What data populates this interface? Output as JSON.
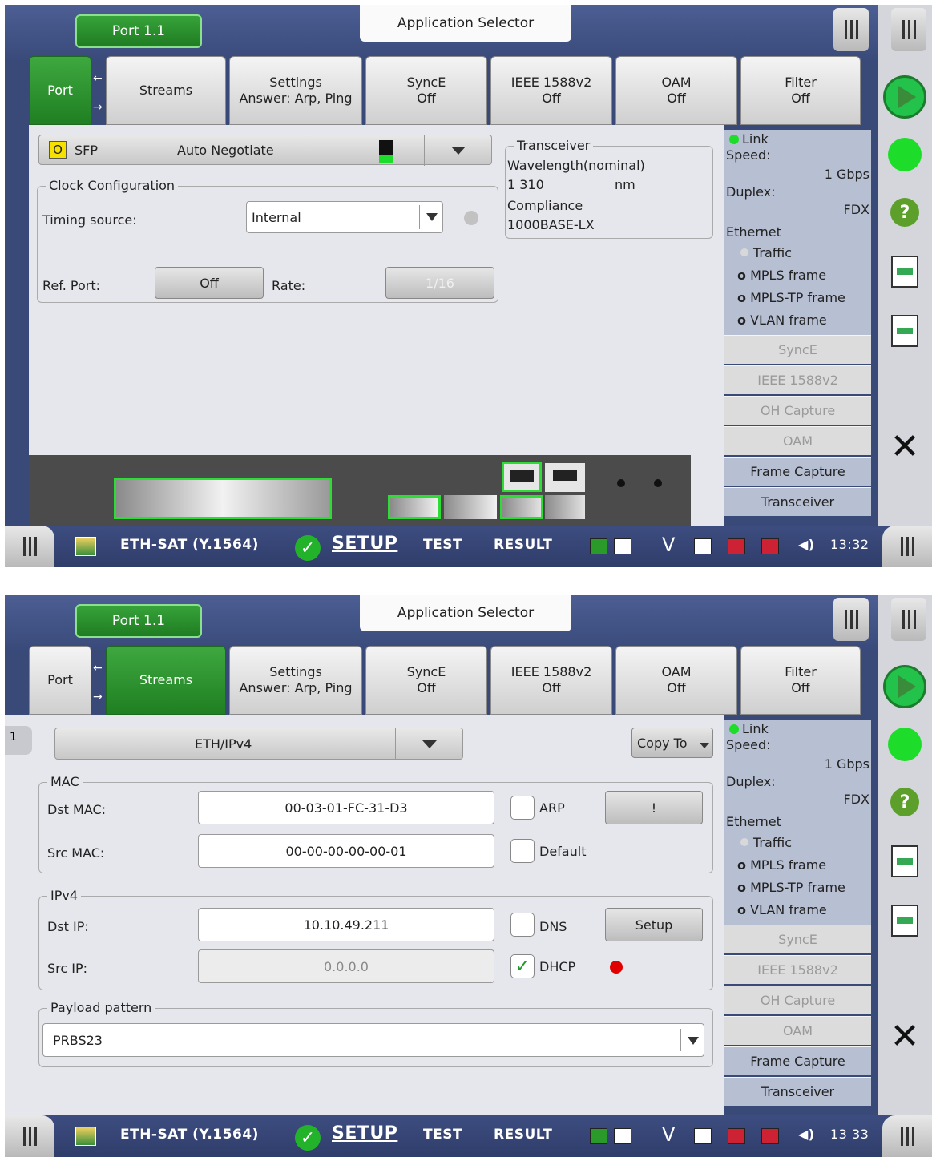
{
  "screens": [
    {
      "port_tab": "Port 1.1",
      "app_selector": "Application Selector",
      "tabs": [
        {
          "line1": "Port",
          "line2": ""
        },
        {
          "line1": "Streams",
          "line2": ""
        },
        {
          "line1": "Settings",
          "line2": "Answer: Arp, Ping"
        },
        {
          "line1": "SyncE",
          "line2": "Off"
        },
        {
          "line1": "IEEE 1588v2",
          "line2": "Off"
        },
        {
          "line1": "OAM",
          "line2": "Off"
        },
        {
          "line1": "Filter",
          "line2": "Off"
        }
      ],
      "active_tab": "Port",
      "port_panel": {
        "sfp_badge": "O",
        "sfp_label": "SFP",
        "negotiation": "Auto Negotiate",
        "clock_title": "Clock Configuration",
        "timing_label": "Timing source:",
        "timing_value": "Internal",
        "ref_port_label": "Ref. Port:",
        "ref_port_value": "Off",
        "rate_label": "Rate:",
        "rate_value": "1/16",
        "transceiver_title": "Transceiver",
        "wavelength_label": "Wavelength(nominal)",
        "wavelength_value": "1 310",
        "wavelength_unit": "nm",
        "compliance_label": "Compliance",
        "compliance_value": "1000BASE-LX"
      },
      "status": {
        "link": "Link",
        "speed_label": "Speed:",
        "speed_value": "1 Gbps",
        "duplex_label": "Duplex:",
        "duplex_value": "FDX",
        "ethernet": "Ethernet",
        "traffic": "Traffic",
        "mpls": "MPLS frame",
        "mpls_tp": "MPLS-TP frame",
        "vlan": "VLAN frame",
        "buttons": [
          "SyncE",
          "IEEE 1588v2",
          "OH Capture",
          "OAM",
          "Frame Capture",
          "Transceiver"
        ]
      },
      "bottom": {
        "app": "ETH-SAT (Y.1564)",
        "setup": "SETUP",
        "test": "TEST",
        "result": "RESULT",
        "v": "V",
        "time": "13:32"
      }
    },
    {
      "port_tab": "Port 1.1",
      "app_selector": "Application Selector",
      "tabs": [
        {
          "line1": "Port",
          "line2": ""
        },
        {
          "line1": "Streams",
          "line2": ""
        },
        {
          "line1": "Settings",
          "line2": "Answer: Arp, Ping"
        },
        {
          "line1": "SyncE",
          "line2": "Off"
        },
        {
          "line1": "IEEE 1588v2",
          "line2": "Off"
        },
        {
          "line1": "OAM",
          "line2": "Off"
        },
        {
          "line1": "Filter",
          "line2": "Off"
        }
      ],
      "active_tab": "Streams",
      "streams_panel": {
        "stream_number": "1",
        "frame_format": "ETH/IPv4",
        "copy_to": "Copy To",
        "mac_title": "MAC",
        "dst_mac_label": "Dst MAC:",
        "dst_mac_value": "00-03-01-FC-31-D3",
        "arp_label": "ARP",
        "arp_btn": "!",
        "src_mac_label": "Src MAC:",
        "src_mac_value": "00-00-00-00-00-01",
        "default_label": "Default",
        "ipv4_title": "IPv4",
        "dst_ip_label": "Dst IP:",
        "dst_ip_value": "10.10.49.211",
        "dns_label": "DNS",
        "setup_btn": "Setup",
        "src_ip_label": "Src IP:",
        "src_ip_value": "0.0.0.0",
        "dhcp_label": "DHCP",
        "dhcp_checked": "✓",
        "payload_title": "Payload pattern",
        "payload_value": "PRBS23"
      },
      "status": {
        "link": "Link",
        "speed_label": "Speed:",
        "speed_value": "1 Gbps",
        "duplex_label": "Duplex:",
        "duplex_value": "FDX",
        "ethernet": "Ethernet",
        "traffic": "Traffic",
        "mpls": "MPLS frame",
        "mpls_tp": "MPLS-TP frame",
        "vlan": "VLAN frame",
        "buttons": [
          "SyncE",
          "IEEE 1588v2",
          "OH Capture",
          "OAM",
          "Frame Capture",
          "Transceiver"
        ]
      },
      "bottom": {
        "app": "ETH-SAT (Y.1564)",
        "setup": "SETUP",
        "test": "TEST",
        "result": "RESULT",
        "v": "V",
        "time": "13 33"
      }
    }
  ],
  "colors": {
    "active_green": "#1f7f22",
    "link_green": "#1edc2a",
    "dhcp_red": "#e00000",
    "frame_blue": "#3a4a78"
  }
}
